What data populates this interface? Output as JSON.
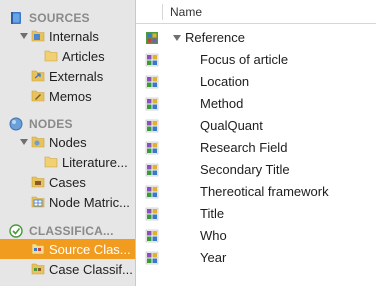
{
  "sidebar": {
    "sources": {
      "header": "SOURCES",
      "internals": "Internals",
      "articles": "Articles",
      "externals": "Externals",
      "memos": "Memos"
    },
    "nodes": {
      "header": "NODES",
      "nodes": "Nodes",
      "literature": "Literature...",
      "cases": "Cases",
      "node_matrices": "Node Matric..."
    },
    "classifications": {
      "header": "CLASSIFICA...",
      "source_classifications": "Source Clas...",
      "case_classifications": "Case Classif..."
    }
  },
  "main": {
    "column_header": "Name",
    "root": "Reference",
    "children": [
      "Focus of article",
      "Location",
      "Method",
      "QualQuant",
      "Research Field",
      "Secondary Title",
      "Thereotical framework",
      "Title",
      "Who",
      "Year"
    ]
  },
  "colors": {
    "selection": "#f29c1f",
    "sidebar_bg": "#e6e6e6",
    "header_text": "#8a8a8a",
    "folder": "#e8c25a"
  }
}
